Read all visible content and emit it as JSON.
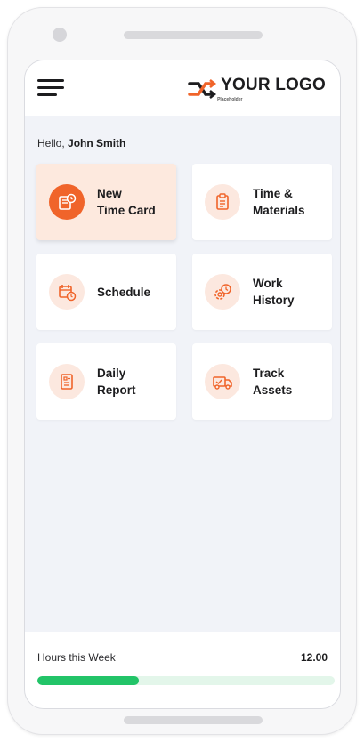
{
  "header": {
    "logo_text": "YOUR LOGO",
    "logo_subtext": "Placeholder"
  },
  "greeting": {
    "prefix": "Hello,",
    "name": "John Smith"
  },
  "tiles": [
    {
      "label": "New\nTime Card",
      "icon": "time-card-icon",
      "active": true
    },
    {
      "label": "Time &\nMaterials",
      "icon": "clipboard-icon",
      "active": false
    },
    {
      "label": "Schedule",
      "icon": "calendar-clock-icon",
      "active": false
    },
    {
      "label": "Work\nHistory",
      "icon": "gear-clock-icon",
      "active": false
    },
    {
      "label": "Daily\nReport",
      "icon": "report-icon",
      "active": false
    },
    {
      "label": "Track\nAssets",
      "icon": "truck-icon",
      "active": false
    }
  ],
  "footer": {
    "hours_label": "Hours this Week",
    "hours_value": "12.00",
    "progress_fraction": 0.34
  },
  "colors": {
    "accent": "#f0642a",
    "accent_light": "#fce8df",
    "progress": "#22c468",
    "progress_track": "#e3f6ea"
  }
}
